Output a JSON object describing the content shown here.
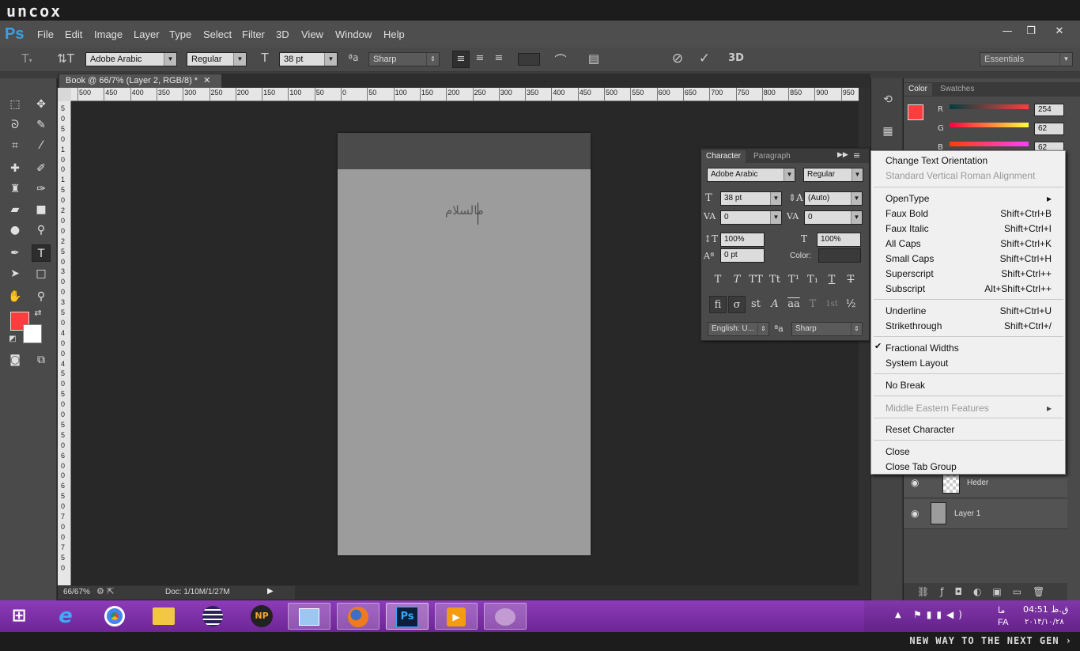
{
  "brand": {
    "title": "uncox",
    "footer": "NEW WAY TO THE NEXT GEN ›"
  },
  "menubar": {
    "logo": "Ps",
    "items": [
      "File",
      "Edit",
      "Image",
      "Layer",
      "Type",
      "Select",
      "Filter",
      "3D",
      "View",
      "Window",
      "Help"
    ],
    "window_buttons": [
      "—",
      "❐",
      "✕"
    ]
  },
  "options": {
    "font_family": "Adobe Arabic",
    "font_style": "Regular",
    "font_size": "38 pt",
    "antialias": "Sharp",
    "label_3d": "3D",
    "workspace": "Essentials"
  },
  "document": {
    "tab_title": "Book @ 66/7% (Layer 2, RGB/8) *",
    "zoom": "66/67%",
    "doc_info": "Doc: 1/10M/1/27M",
    "typed_text": "مالسلام"
  },
  "ruler": {
    "h_ticks": [
      "500",
      "450",
      "400",
      "350",
      "300",
      "250",
      "200",
      "150",
      "100",
      "50",
      "0",
      "50",
      "100",
      "150",
      "200",
      "250",
      "300",
      "350",
      "400",
      "450",
      "500",
      "550",
      "600",
      "650",
      "700",
      "750",
      "800",
      "850",
      "900",
      "950"
    ],
    "v_ticks": [
      "5",
      "0",
      "5",
      "0",
      "1",
      "0",
      "0",
      "1",
      "5",
      "0",
      "2",
      "0",
      "0",
      "2",
      "5",
      "0",
      "3",
      "0",
      "0",
      "3",
      "5",
      "0",
      "4",
      "0",
      "0",
      "4",
      "5",
      "0",
      "5",
      "0",
      "0",
      "5",
      "5",
      "0",
      "6",
      "0",
      "0",
      "6",
      "5",
      "0",
      "7",
      "0",
      "0",
      "7",
      "5",
      "0"
    ]
  },
  "color_panel": {
    "tabs": [
      "Color",
      "Swatches"
    ],
    "channels": [
      {
        "label": "R",
        "value": "254"
      },
      {
        "label": "G",
        "value": "62"
      },
      {
        "label": "B",
        "value": "62"
      }
    ],
    "foreground": "#fe3e3e",
    "background": "#ffffff"
  },
  "character_panel": {
    "tabs": [
      "Character",
      "Paragraph"
    ],
    "font_family": "Adobe Arabic",
    "font_style": "Regular",
    "size": "38 pt",
    "leading": "(Auto)",
    "kerning": "0",
    "tracking": "0",
    "vscale": "100%",
    "hscale": "100%",
    "baseline": "0 pt",
    "color_label": "Color:",
    "type_styles": [
      "T",
      "T",
      "TT",
      "Tt",
      "T¹",
      "T₁",
      "T",
      "T"
    ],
    "opentype": [
      "fi",
      "σ",
      "st",
      "A",
      "aa",
      "T",
      "1st",
      "½"
    ],
    "language": "English: U...",
    "antialias": "Sharp"
  },
  "context_menu": {
    "items": [
      {
        "label": "Change Text Orientation",
        "shortcut": "",
        "disabled": false
      },
      {
        "label": "Standard Vertical Roman Alignment",
        "shortcut": "",
        "disabled": true
      },
      {
        "label": "OpenType",
        "shortcut": "▸",
        "disabled": false
      },
      {
        "label": "Faux Bold",
        "shortcut": "Shift+Ctrl+B",
        "disabled": false
      },
      {
        "label": "Faux Italic",
        "shortcut": "Shift+Ctrl+I",
        "disabled": false
      },
      {
        "label": "All Caps",
        "shortcut": "Shift+Ctrl+K",
        "disabled": false
      },
      {
        "label": "Small Caps",
        "shortcut": "Shift+Ctrl+H",
        "disabled": false
      },
      {
        "label": "Superscript",
        "shortcut": "Shift+Ctrl++",
        "disabled": false
      },
      {
        "label": "Subscript",
        "shortcut": "Alt+Shift+Ctrl++",
        "disabled": false
      },
      {
        "label": "Underline",
        "shortcut": "Shift+Ctrl+U",
        "disabled": false
      },
      {
        "label": "Strikethrough",
        "shortcut": "Shift+Ctrl+/",
        "disabled": false
      },
      {
        "label": "Fractional Widths",
        "shortcut": "",
        "disabled": false,
        "checked": "✔"
      },
      {
        "label": "System Layout",
        "shortcut": "",
        "disabled": false
      },
      {
        "label": "No Break",
        "shortcut": "",
        "disabled": false
      },
      {
        "label": "Middle Eastern Features",
        "shortcut": "▸",
        "disabled": true
      },
      {
        "label": "Reset Character",
        "shortcut": "",
        "disabled": false
      },
      {
        "label": "Close",
        "shortcut": "",
        "disabled": false
      },
      {
        "label": "Close Tab Group",
        "shortcut": "",
        "disabled": false
      }
    ]
  },
  "layers": [
    {
      "name": "Heder"
    },
    {
      "name": "Layer 1"
    }
  ],
  "taskbar": {
    "apps": [
      "windows-start-icon",
      "internet-explorer-icon",
      "chrome-icon",
      "file-explorer-icon",
      "eclipse-icon",
      "np-icon",
      "control-panel-icon",
      "firefox-icon",
      "photoshop-icon",
      "media-player-icon",
      "app-icon"
    ],
    "np_label": "NP",
    "ps_label": "Ps",
    "clock": "04:51 ق.ظ",
    "date": "۲۰۱۴/۱۰/۲۸",
    "lang": "FA",
    "day": "ما"
  }
}
